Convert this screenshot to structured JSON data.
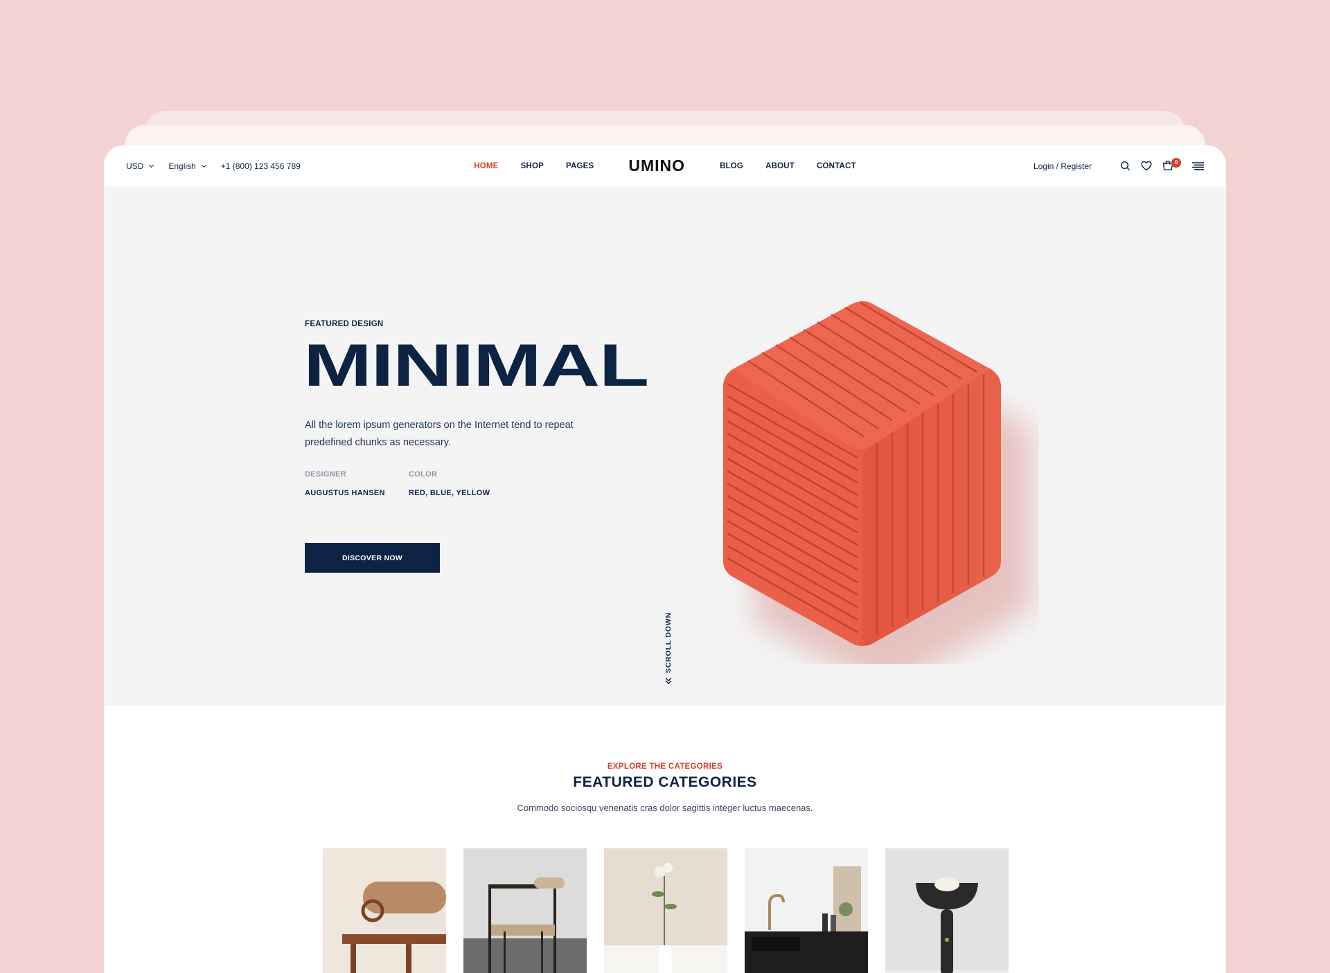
{
  "header": {
    "currency": "USD",
    "language": "English",
    "phone": "+1 (800) 123 456 789",
    "nav_left": [
      "HOME",
      "SHOP",
      "PAGES"
    ],
    "logo": "UMINO",
    "nav_right": [
      "BLOG",
      "ABOUT",
      "CONTACT"
    ],
    "login": "Login / Register",
    "cart_count": "0",
    "icons": [
      "search-icon",
      "heart-icon",
      "cart-icon",
      "menu-icon"
    ]
  },
  "hero": {
    "kicker": "FEATURED DESIGN",
    "title": "MINIMAL",
    "description": "All the lorem ipsum generators on the Internet tend to repeat predefined chunks as necessary.",
    "designer_label": "DESIGNER",
    "designer_value": "AUGUSTUS HANSEN",
    "color_label": "COLOR",
    "color_value": "RED, BLUE, YELLOW",
    "cta": "DISCOVER NOW",
    "scroll": "SCROLL DOWN"
  },
  "categories": {
    "kicker": "EXPLORE THE CATEGORIES",
    "title": "FEATURED CATEGORIES",
    "subtitle": "Commodo sociosqu venenatis cras dolor sagittis integer luctus maecenas."
  },
  "colors": {
    "accent": "#d6402c",
    "navy": "#0d2344",
    "page_bg": "#f3d2d2",
    "hero_bg": "#f4f4f5"
  }
}
